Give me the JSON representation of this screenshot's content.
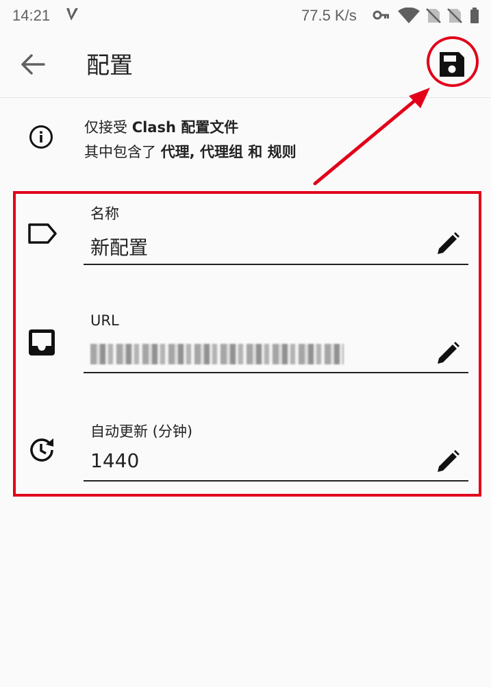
{
  "status_bar": {
    "time": "14:21",
    "net_speed": "77.5 K/s"
  },
  "app_bar": {
    "title": "配置"
  },
  "info": {
    "line1_prefix": "仅接受 ",
    "line1_bold": "Clash 配置文件",
    "line2_prefix": "其中包含了 ",
    "line2_bold": "代理, 代理组 和 规则"
  },
  "fields": {
    "name": {
      "label": "名称",
      "value": "新配置"
    },
    "url": {
      "label": "URL",
      "value": ""
    },
    "update": {
      "label": "自动更新 (分钟)",
      "value": "1440"
    }
  },
  "colors": {
    "annotation": "#e2001a",
    "text": "#212121",
    "background": "#fafafa"
  }
}
